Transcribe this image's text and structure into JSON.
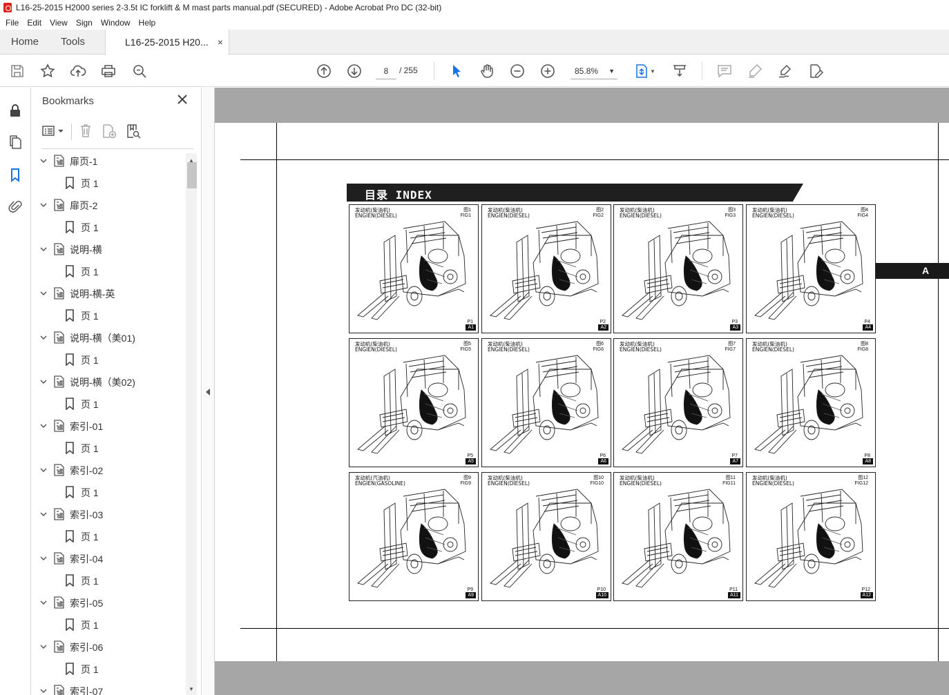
{
  "window": {
    "title": "L16-25-2015 H2000 series 2-3.5t IC forklift & M mast parts manual.pdf (SECURED) - Adobe Acrobat Pro DC (32-bit)"
  },
  "menu": [
    "File",
    "Edit",
    "View",
    "Sign",
    "Window",
    "Help"
  ],
  "tabs": {
    "home": "Home",
    "tools": "Tools",
    "document": "L16-25-2015 H20...",
    "close": "×"
  },
  "toolbar": {
    "page_current": "8",
    "page_total": "/  255",
    "zoom": "85.8%"
  },
  "bookmarks": {
    "title": "Bookmarks",
    "items": [
      {
        "label": "扉页-1",
        "level": 0
      },
      {
        "label": "页 1",
        "level": 1
      },
      {
        "label": "扉页-2",
        "level": 0
      },
      {
        "label": "页 1",
        "level": 1
      },
      {
        "label": "说明-横",
        "level": 0
      },
      {
        "label": "页 1",
        "level": 1
      },
      {
        "label": "说明-横-英",
        "level": 0
      },
      {
        "label": "页 1",
        "level": 1
      },
      {
        "label": "说明-横（美01)",
        "level": 0
      },
      {
        "label": "页 1",
        "level": 1
      },
      {
        "label": "说明-横（美02)",
        "level": 0
      },
      {
        "label": "页 1",
        "level": 1
      },
      {
        "label": "索引-01",
        "level": 0
      },
      {
        "label": "页 1",
        "level": 1
      },
      {
        "label": "索引-02",
        "level": 0
      },
      {
        "label": "页 1",
        "level": 1
      },
      {
        "label": "索引-03",
        "level": 0
      },
      {
        "label": "页 1",
        "level": 1
      },
      {
        "label": "索引-04",
        "level": 0
      },
      {
        "label": "页 1",
        "level": 1
      },
      {
        "label": "索引-05",
        "level": 0
      },
      {
        "label": "页 1",
        "level": 1
      },
      {
        "label": "索引-06",
        "level": 0
      },
      {
        "label": "页 1",
        "level": 1
      },
      {
        "label": "索引-07",
        "level": 0
      }
    ]
  },
  "document": {
    "heading": "目录  INDEX",
    "side_tab": "A",
    "figures": [
      {
        "caption_cn": "发动机(柴油机)",
        "caption_en": "ENGIEN(DIESEL)",
        "fig_cn": "图1",
        "fig_en": "FIG1",
        "page": "P1",
        "code": "A1"
      },
      {
        "caption_cn": "发动机(柴油机)",
        "caption_en": "ENGIEN(DIESEL)",
        "fig_cn": "图2",
        "fig_en": "FIG2",
        "page": "P2",
        "code": "A2"
      },
      {
        "caption_cn": "发动机(柴油机)",
        "caption_en": "ENGIEN(DIESEL)",
        "fig_cn": "图3",
        "fig_en": "FIG3",
        "page": "P3",
        "code": "A3"
      },
      {
        "caption_cn": "发动机(柴油机)",
        "caption_en": "ENGIEN(DIESEL)",
        "fig_cn": "图4",
        "fig_en": "FIG4",
        "page": "P4",
        "code": "A4"
      },
      {
        "caption_cn": "发动机(柴油机)",
        "caption_en": "ENGIEN(DIESEL)",
        "fig_cn": "图5",
        "fig_en": "FIG5",
        "page": "P5",
        "code": "A5"
      },
      {
        "caption_cn": "发动机(柴油机)",
        "caption_en": "ENGIEN(DIESEL)",
        "fig_cn": "图6",
        "fig_en": "FIG6",
        "page": "P6",
        "code": "A6"
      },
      {
        "caption_cn": "发动机(柴油机)",
        "caption_en": "ENGIEN(DIESEL)",
        "fig_cn": "图7",
        "fig_en": "FIG7",
        "page": "P7",
        "code": "A7"
      },
      {
        "caption_cn": "发动机(柴油机)",
        "caption_en": "ENGIEN(DIESEL)",
        "fig_cn": "图8",
        "fig_en": "FIG8",
        "page": "P8",
        "code": "A8"
      },
      {
        "caption_cn": "发动机(汽油机)",
        "caption_en": "ENGIEN(GASOLINE)",
        "fig_cn": "图9",
        "fig_en": "FIG9",
        "page": "P9",
        "code": "A9"
      },
      {
        "caption_cn": "发动机(柴油机)",
        "caption_en": "ENGIEN(DIESEL)",
        "fig_cn": "图10",
        "fig_en": "FIG10",
        "page": "P10",
        "code": "A10"
      },
      {
        "caption_cn": "发动机(柴油机)",
        "caption_en": "ENGIEN(DIESEL)",
        "fig_cn": "图11",
        "fig_en": "FIG11",
        "page": "P11",
        "code": "A11"
      },
      {
        "caption_cn": "发动机(柴油机)",
        "caption_en": "ENGIEN(DIESEL)",
        "fig_cn": "图12",
        "fig_en": "FIG12",
        "page": "P12",
        "code": "A12"
      }
    ]
  },
  "colors": {
    "acrobat_red": "#e0241b",
    "select_blue": "#1473e6",
    "doc_background": "#a6a6a6"
  }
}
